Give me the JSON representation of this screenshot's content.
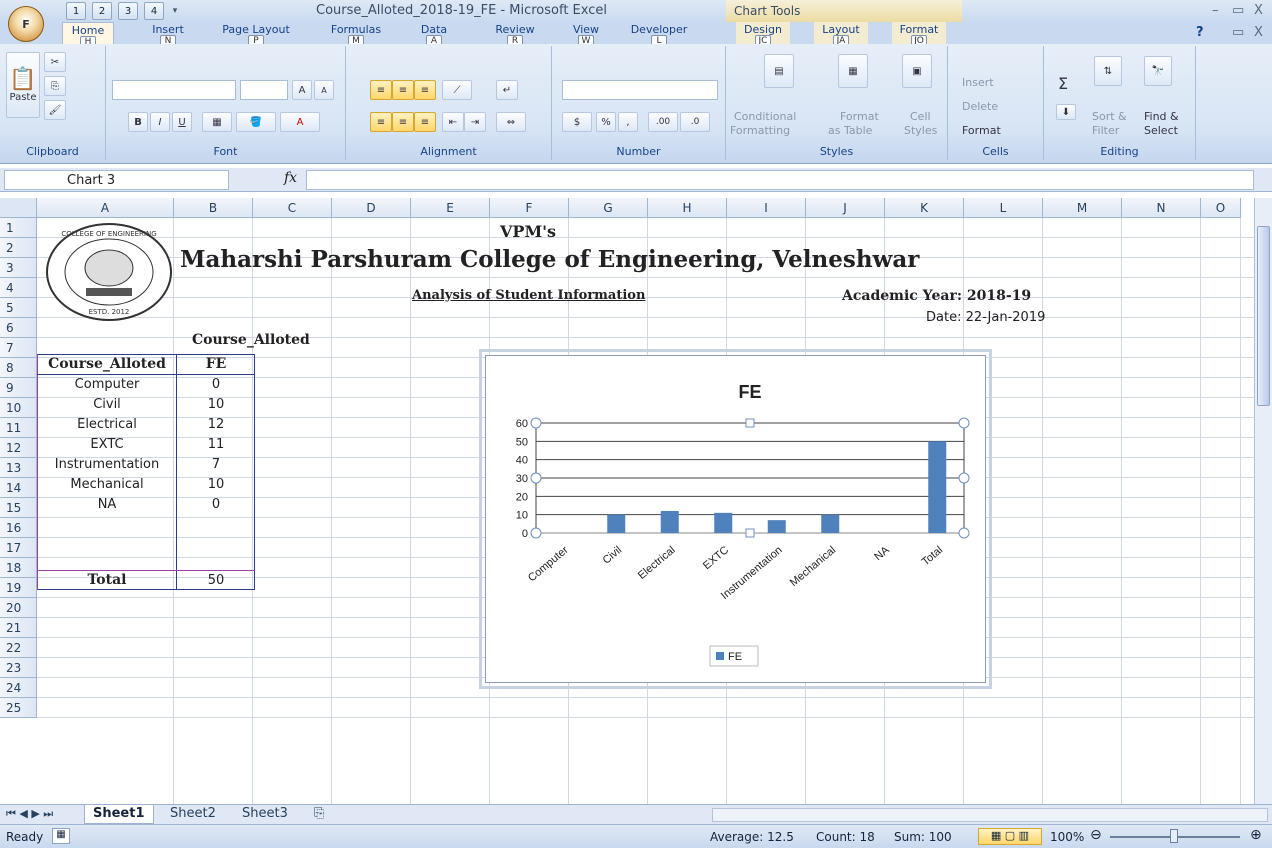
{
  "window": {
    "title": "Course_Alloted_2018-19_FE - Microsoft Excel",
    "context_tools": "Chart Tools",
    "office_key": "F",
    "min": "–",
    "restore": "▭",
    "close": "X",
    "help": "?"
  },
  "quick_access": [
    {
      "key": "1"
    },
    {
      "key": "2"
    },
    {
      "key": "3"
    },
    {
      "key": "4"
    }
  ],
  "ribbon_tabs": [
    {
      "label": "Home",
      "key": "H"
    },
    {
      "label": "Insert",
      "key": "N"
    },
    {
      "label": "Page Layout",
      "key": "P"
    },
    {
      "label": "Formulas",
      "key": "M"
    },
    {
      "label": "Data",
      "key": "A"
    },
    {
      "label": "Review",
      "key": "R"
    },
    {
      "label": "View",
      "key": "W"
    },
    {
      "label": "Developer",
      "key": "L"
    },
    {
      "label": "Design",
      "key": "JC"
    },
    {
      "label": "Layout",
      "key": "JA"
    },
    {
      "label": "Format",
      "key": "JO"
    }
  ],
  "ribbon": {
    "clipboard": {
      "label": "Clipboard",
      "paste": "Paste"
    },
    "font": {
      "label": "Font",
      "bold": "B",
      "italic": "I",
      "underline": "U",
      "grow": "A",
      "shrink": "A",
      "color": "A"
    },
    "alignment": {
      "label": "Alignment"
    },
    "number": {
      "label": "Number",
      "currency": "$",
      "percent": "%",
      "comma": ",",
      "inc": ".00",
      "dec": ".0"
    },
    "styles": {
      "label": "Styles",
      "conditional": "Conditional",
      "conditional2": "Formatting",
      "format_table": "Format",
      "format_table2": "as Table",
      "cell_styles": "Cell",
      "cell_styles2": "Styles"
    },
    "cells": {
      "label": "Cells",
      "insert": "Insert",
      "delete": "Delete",
      "format": "Format"
    },
    "editing": {
      "label": "Editing",
      "sum": "Σ",
      "sort": "Sort &",
      "sort2": "Filter",
      "find": "Find &",
      "find2": "Select"
    }
  },
  "formula_bar": {
    "name_box": "Chart 3",
    "fx": "fx",
    "formula": ""
  },
  "columns": [
    "A",
    "B",
    "C",
    "D",
    "E",
    "F",
    "G",
    "H",
    "I",
    "J",
    "K",
    "L",
    "M",
    "N",
    "O"
  ],
  "rows": [
    "1",
    "2",
    "3",
    "4",
    "5",
    "6",
    "7",
    "8",
    "9",
    "10",
    "11",
    "12",
    "13",
    "14",
    "15",
    "16",
    "17",
    "18",
    "19",
    "20",
    "21",
    "22",
    "23",
    "24",
    "25"
  ],
  "sheet": {
    "logo_text": "COLLEGE OF ENGINEERING",
    "logo_estd": "ESTD. 2012",
    "vpm": "VPM's",
    "college": "Maharshi Parshuram College of Engineering, Velneshwar",
    "analysis": "Analysis of Student Information",
    "academic_year": "Academic Year: 2018-19",
    "date": "Date: 22-Jan-2019",
    "table_title": "Course_Alloted",
    "header": {
      "col1": "Course_Alloted",
      "col2": "FE"
    },
    "rows": [
      {
        "course": "Computer",
        "fe": "0"
      },
      {
        "course": "Civil",
        "fe": "10"
      },
      {
        "course": "Electrical",
        "fe": "12"
      },
      {
        "course": "EXTC",
        "fe": "11"
      },
      {
        "course": "Instrumentation",
        "fe": "7"
      },
      {
        "course": "Mechanical",
        "fe": "10"
      },
      {
        "course": "NA",
        "fe": "0"
      },
      {
        "course": "",
        "fe": ""
      }
    ],
    "total": {
      "label": "Total",
      "value": "50"
    }
  },
  "chart_data": {
    "type": "bar",
    "title": "FE",
    "categories": [
      "Computer",
      "Civil",
      "Electrical",
      "EXTC",
      "Instrumentation",
      "Mechanical",
      "NA",
      "Total"
    ],
    "series": [
      {
        "name": "FE",
        "values": [
          0,
          10,
          12,
          11,
          7,
          10,
          0,
          50
        ],
        "color": "#4f81bd"
      }
    ],
    "ylim": [
      0,
      60
    ],
    "yticks": [
      "0",
      "10",
      "20",
      "30",
      "40",
      "50",
      "60"
    ],
    "grid": true,
    "legend": "bottom"
  },
  "sheet_tabs": [
    "Sheet1",
    "Sheet2",
    "Sheet3"
  ],
  "status": {
    "ready": "Ready",
    "average": "Average: 12.5",
    "count": "Count: 18",
    "sum": "Sum: 100",
    "zoom": "100%"
  }
}
